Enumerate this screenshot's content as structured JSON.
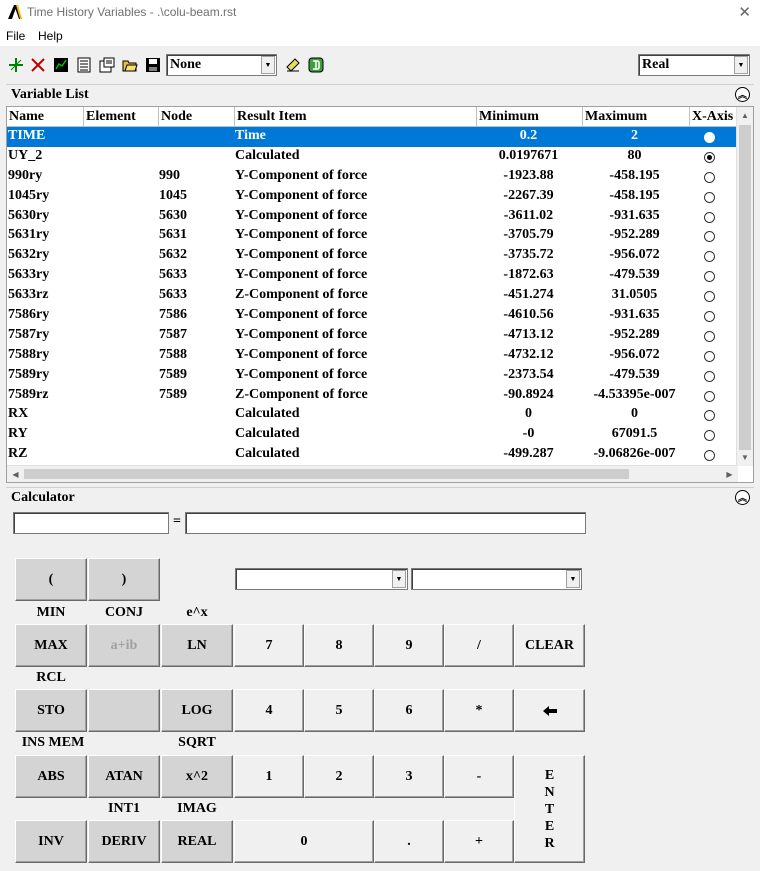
{
  "window": {
    "title": "Time History Variables - .\\colu-beam.rst",
    "close_glyph": "✕"
  },
  "menu": {
    "file": "File",
    "help": "Help"
  },
  "toolbar": {
    "dropdown_value": "None",
    "real_value": "Real",
    "icons": [
      "add-variable-icon",
      "delete-variable-icon",
      "graph-icon",
      "list-icon",
      "properties-icon",
      "open-icon",
      "save-icon",
      "clear-icon",
      "refresh-icon"
    ]
  },
  "variable_list": {
    "title": "Variable List",
    "collapse_glyph": "︽",
    "headers": [
      "Name",
      "Element",
      "Node",
      "Result Item",
      "Minimum",
      "Maximum",
      "X-Axis"
    ],
    "rows": [
      {
        "name": "TIME",
        "element": "",
        "node": "",
        "result": "Time",
        "min": "0.2",
        "max": "2",
        "xaxis": false,
        "selected": true
      },
      {
        "name": "UY_2",
        "element": "",
        "node": "",
        "result": "Calculated",
        "min": "0.0197671",
        "max": "80",
        "xaxis": true,
        "selected": false
      },
      {
        "name": "990ry",
        "element": "",
        "node": "990",
        "result": "Y-Component of force",
        "min": "-1923.88",
        "max": "-458.195",
        "xaxis": false,
        "selected": false
      },
      {
        "name": "1045ry",
        "element": "",
        "node": "1045",
        "result": "Y-Component of force",
        "min": "-2267.39",
        "max": "-458.195",
        "xaxis": false,
        "selected": false
      },
      {
        "name": "5630ry",
        "element": "",
        "node": "5630",
        "result": "Y-Component of force",
        "min": "-3611.02",
        "max": "-931.635",
        "xaxis": false,
        "selected": false
      },
      {
        "name": "5631ry",
        "element": "",
        "node": "5631",
        "result": "Y-Component of force",
        "min": "-3705.79",
        "max": "-952.289",
        "xaxis": false,
        "selected": false
      },
      {
        "name": "5632ry",
        "element": "",
        "node": "5632",
        "result": "Y-Component of force",
        "min": "-3735.72",
        "max": "-956.072",
        "xaxis": false,
        "selected": false
      },
      {
        "name": "5633ry",
        "element": "",
        "node": "5633",
        "result": "Y-Component of force",
        "min": "-1872.63",
        "max": "-479.539",
        "xaxis": false,
        "selected": false
      },
      {
        "name": "5633rz",
        "element": "",
        "node": "5633",
        "result": "Z-Component of force",
        "min": "-451.274",
        "max": "31.0505",
        "xaxis": false,
        "selected": false
      },
      {
        "name": "7586ry",
        "element": "",
        "node": "7586",
        "result": "Y-Component of force",
        "min": "-4610.56",
        "max": "-931.635",
        "xaxis": false,
        "selected": false
      },
      {
        "name": "7587ry",
        "element": "",
        "node": "7587",
        "result": "Y-Component of force",
        "min": "-4713.12",
        "max": "-952.289",
        "xaxis": false,
        "selected": false
      },
      {
        "name": "7588ry",
        "element": "",
        "node": "7588",
        "result": "Y-Component of force",
        "min": "-4732.12",
        "max": "-956.072",
        "xaxis": false,
        "selected": false
      },
      {
        "name": "7589ry",
        "element": "",
        "node": "7589",
        "result": "Y-Component of force",
        "min": "-2373.54",
        "max": "-479.539",
        "xaxis": false,
        "selected": false
      },
      {
        "name": "7589rz",
        "element": "",
        "node": "7589",
        "result": "Z-Component of force",
        "min": "-90.8924",
        "max": "-4.53395e-007",
        "xaxis": false,
        "selected": false
      },
      {
        "name": "RX",
        "element": "",
        "node": "",
        "result": "Calculated",
        "min": "0",
        "max": "0",
        "xaxis": false,
        "selected": false
      },
      {
        "name": "RY",
        "element": "",
        "node": "",
        "result": "Calculated",
        "min": "-0",
        "max": "67091.5",
        "xaxis": false,
        "selected": false
      },
      {
        "name": "RZ",
        "element": "",
        "node": "",
        "result": "Calculated",
        "min": "-499.287",
        "max": "-9.06826e-007",
        "xaxis": false,
        "selected": false
      }
    ]
  },
  "calculator": {
    "title": "Calculator",
    "collapse_glyph": "︽",
    "equals": "=",
    "labels": {
      "min": "MIN",
      "conj": "CONJ",
      "exp": "e^x",
      "rcl": "RCL",
      "ins_mem": "INS MEM",
      "sqrt": "SQRT",
      "int1": "INT1",
      "imag": "IMAG"
    },
    "buttons": {
      "lparen": "(",
      "rparen": ")",
      "max": "MAX",
      "aib": "a+ib",
      "ln": "LN",
      "sto": "STO",
      "blank": "",
      "log": "LOG",
      "abs": "ABS",
      "atan": "ATAN",
      "x2": "x^2",
      "inv": "INV",
      "deriv": "DERIV",
      "real": "REAL",
      "n7": "7",
      "n8": "8",
      "n9": "9",
      "div": "/",
      "clear": "CLEAR",
      "n4": "4",
      "n5": "5",
      "n6": "6",
      "mul": "*",
      "back": "🠔",
      "n1": "1",
      "n2": "2",
      "n3": "3",
      "sub": "-",
      "n0": "0",
      "dot": ".",
      "add": "+",
      "enter": [
        "E",
        "N",
        "T",
        "E",
        "R"
      ]
    }
  }
}
